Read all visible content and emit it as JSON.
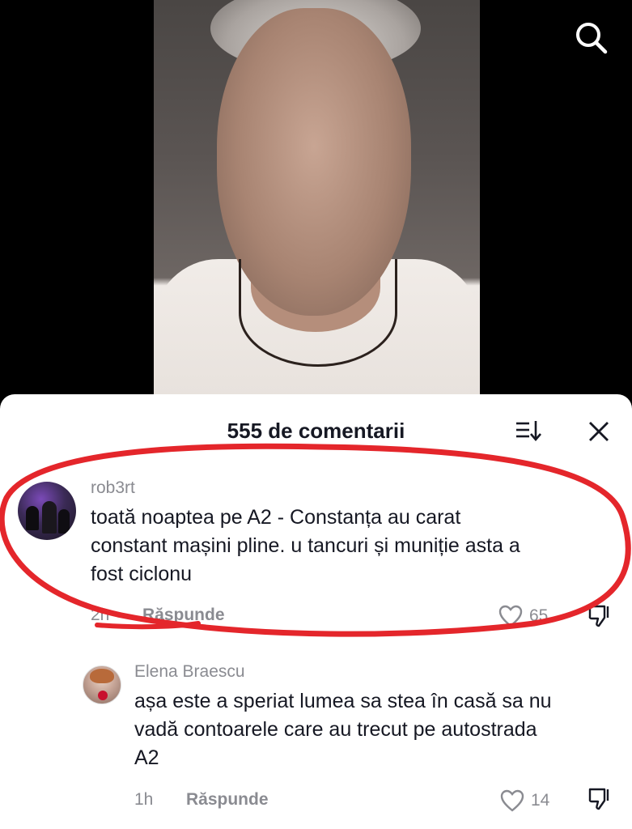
{
  "sheet": {
    "title": "555 de comentarii"
  },
  "comments": [
    {
      "username": "rob3rt",
      "text_lines": [
        "toată noaptea pe A2 - Constanța au carat",
        "constant mașini pline. u tancuri și muniție asta a",
        "fost ciclonu"
      ],
      "time": "2h",
      "reply_label": "Răspunde",
      "likes": "65"
    },
    {
      "username": "Elena Braescu",
      "text_lines": [
        "așa este a speriat lumea sa stea în casă sa nu",
        "vadă contoarele care au trecut pe autostrada",
        "A2"
      ],
      "time": "1h",
      "reply_label": "Răspunde",
      "likes": "14"
    }
  ],
  "icons": {
    "search": "search-icon",
    "sort": "sort-icon",
    "close": "close-icon",
    "like": "heart-icon",
    "dislike": "dislike-icon"
  },
  "colors": {
    "annotation": "#e4262b",
    "text": "#161823",
    "muted": "#8a8b91"
  }
}
